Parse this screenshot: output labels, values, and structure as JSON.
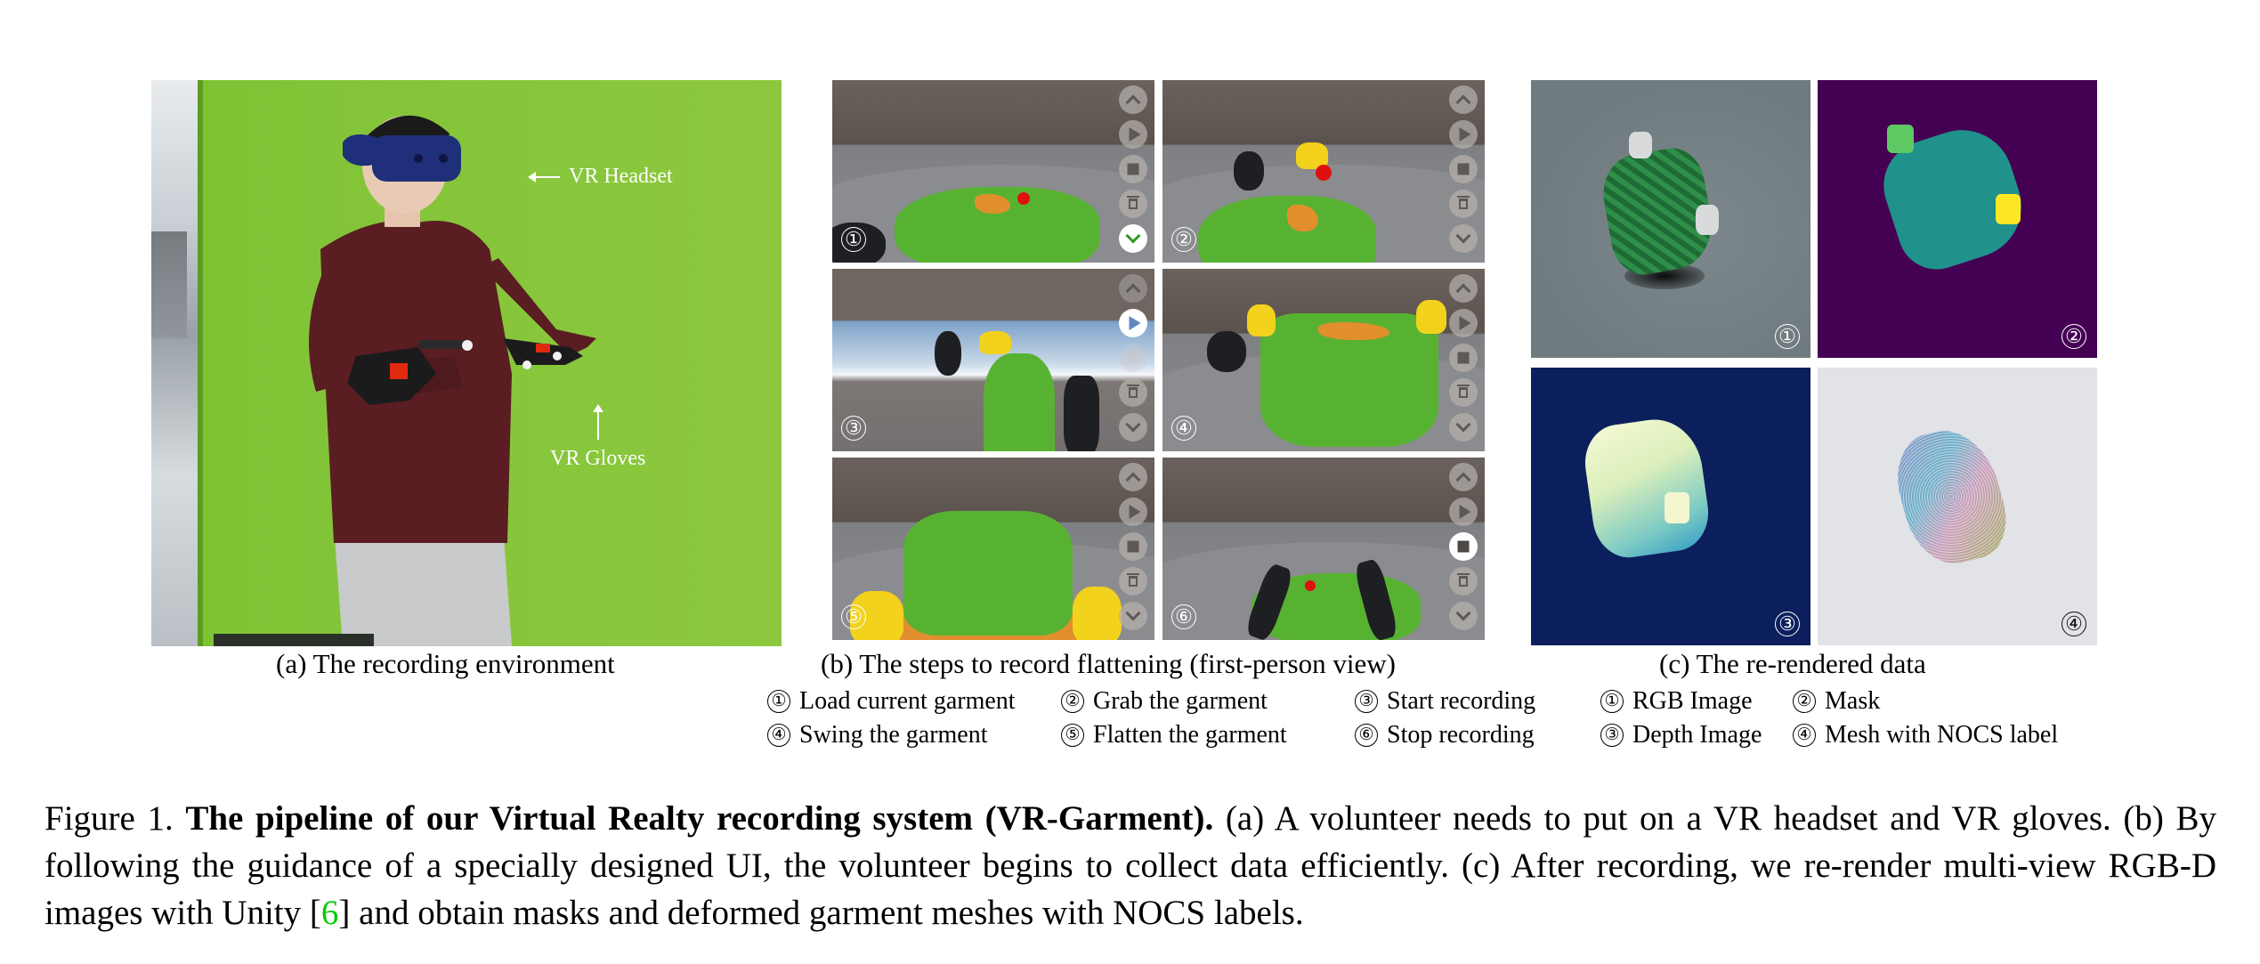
{
  "figure": {
    "panel_a": {
      "annotations": {
        "headset": "VR Headset",
        "gloves": "VR Gloves"
      },
      "subcaption": "(a) The recording environment",
      "colors": {
        "green_screen": "#85c53a",
        "shirt": "#5a1e22",
        "headset": "#1f2f7a",
        "pants": "#c9cacc",
        "gloves": "#1b1b1d",
        "glove_accent": "#e02a10"
      }
    },
    "panel_b": {
      "subcaption": "(b) The steps to record flattening (first-person view)",
      "tiles": [
        {
          "num": "①",
          "active_button": "confirm",
          "active_icon": "chevron-down-icon"
        },
        {
          "num": "②",
          "active_button": "none"
        },
        {
          "num": "③",
          "active_button": "play",
          "active_icon": "play-icon"
        },
        {
          "num": "④",
          "active_button": "none"
        },
        {
          "num": "⑤",
          "active_button": "none"
        },
        {
          "num": "⑥",
          "active_button": "stop",
          "active_icon": "stop-icon"
        }
      ],
      "ui_buttons": [
        "chevron-up-icon",
        "play-icon",
        "stop-icon",
        "trash-icon",
        "chevron-down-icon"
      ],
      "legend": [
        {
          "num": "①",
          "label": "Load current garment"
        },
        {
          "num": "②",
          "label": "Grab the garment"
        },
        {
          "num": "③",
          "label": "Start recording"
        },
        {
          "num": "④",
          "label": "Swing the garment"
        },
        {
          "num": "⑤",
          "label": "Flatten the garment"
        },
        {
          "num": "⑥",
          "label": "Stop recording"
        }
      ],
      "colors": {
        "garment": "#58b232",
        "garment_inside": "#e08f2c",
        "hand": "#f2d21c",
        "marker": "#e01010"
      }
    },
    "panel_c": {
      "subcaption": "(c) The re-rendered data",
      "tiles": [
        {
          "num": "①",
          "kind": "RGB Image",
          "bg": "#6f7b7f"
        },
        {
          "num": "②",
          "kind": "Mask",
          "bg": "#440154"
        },
        {
          "num": "③",
          "kind": "Depth Image",
          "bg": "#0b1f5c"
        },
        {
          "num": "④",
          "kind": "Mesh with NOCS label",
          "bg": "#e1e3e6"
        }
      ],
      "legend": [
        {
          "num": "①",
          "label": "RGB Image"
        },
        {
          "num": "②",
          "label": "Mask"
        },
        {
          "num": "③",
          "label": "Depth Image"
        },
        {
          "num": "④",
          "label": "Mesh with NOCS label"
        }
      ],
      "mask_colors": {
        "background": "#440154",
        "garment": "#21918c",
        "left_hand": "#5ec962",
        "right_hand": "#fde725"
      }
    },
    "caption": {
      "label": "Figure 1.",
      "title": "The pipeline of our Virtual Realty recording system (VR-Garment).",
      "body_1": "(a) A volunteer needs to put on a VR headset and VR gloves. (b) By following the guidance of a specially designed UI, the volunteer begins to collect data efficiently. (c) After recording, we re-render multi-view RGB-D images with Unity [",
      "citation": "6",
      "body_2": "] and obtain masks and deformed garment meshes with NOCS labels.",
      "citation_color": "#00cc00"
    }
  }
}
